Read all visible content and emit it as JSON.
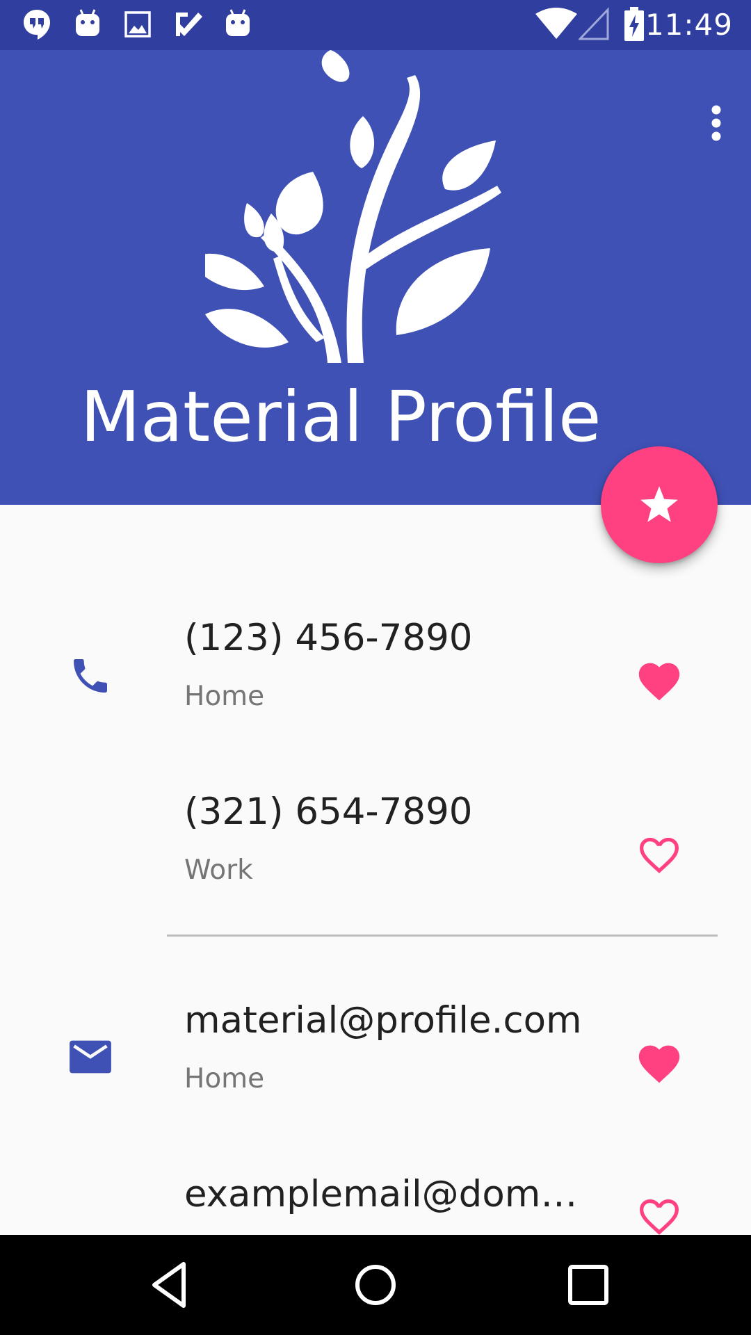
{
  "status_bar": {
    "time": "11:49",
    "left_icons": [
      "hangouts-icon",
      "android-icon",
      "image-icon",
      "check-icon",
      "android-icon"
    ],
    "right_icons": [
      "wifi-icon",
      "signal-icon",
      "battery-charging-icon"
    ]
  },
  "header": {
    "title": "Material Profile",
    "background_color": "#3f51b5",
    "status_color": "#303f9f",
    "logo": "leaf-plant-logo"
  },
  "fab": {
    "icon": "star-icon",
    "color": "#ff4081"
  },
  "contacts": [
    {
      "value": "(123) 456-7890",
      "label": "Home",
      "favorite": true,
      "icon": "phone-icon"
    },
    {
      "value": "(321) 654-7890",
      "label": "Work",
      "favorite": false,
      "icon": ""
    },
    {
      "value": "material@profile.com",
      "label": "Home",
      "favorite": true,
      "icon": "email-icon"
    },
    {
      "value": "examplemail@domain.com",
      "label": "",
      "favorite": false,
      "icon": ""
    }
  ],
  "colors": {
    "accent": "#ff4081",
    "primary": "#3f51b5"
  }
}
